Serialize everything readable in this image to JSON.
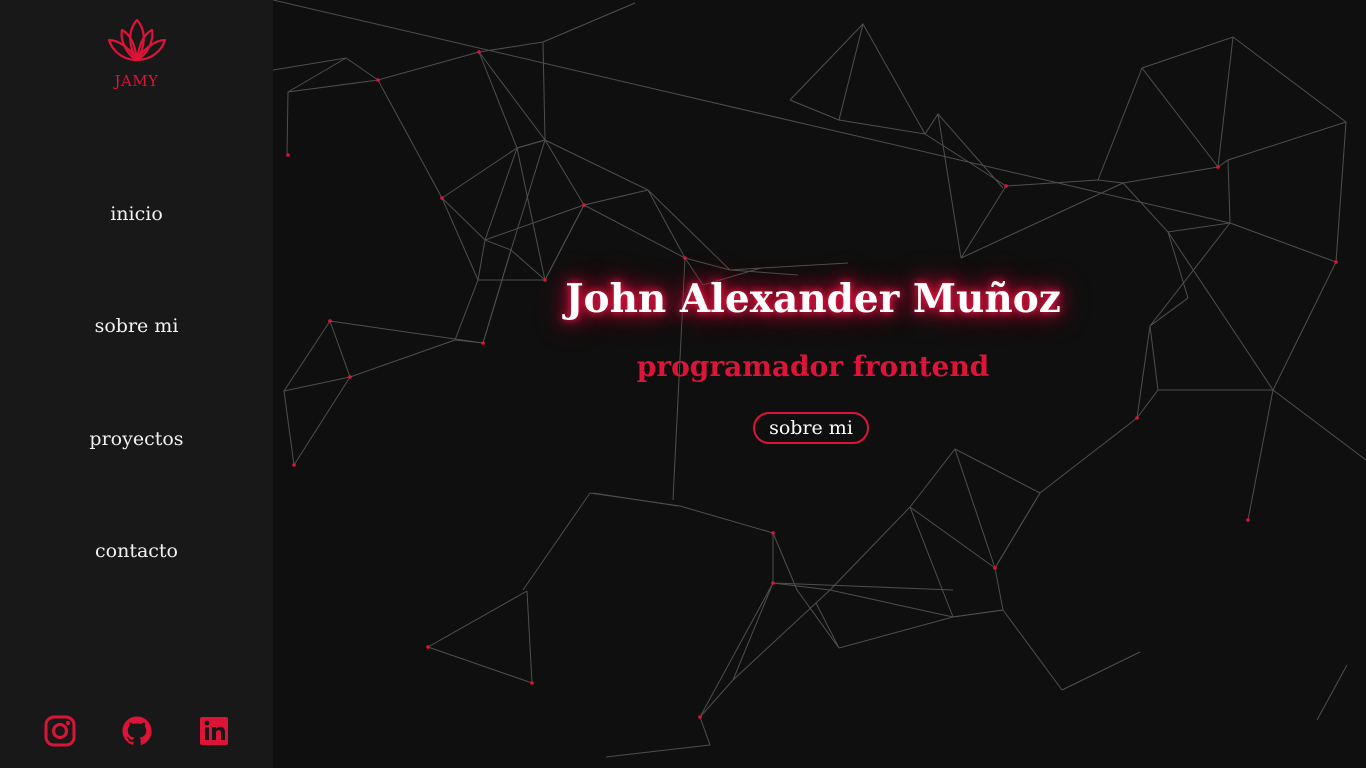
{
  "sidebar": {
    "logo_text": "JAMY",
    "nav": [
      {
        "label": "inicio"
      },
      {
        "label": "sobre mi"
      },
      {
        "label": "proyectos"
      },
      {
        "label": "contacto"
      }
    ],
    "social": [
      {
        "icon": "instagram-icon"
      },
      {
        "icon": "github-icon"
      },
      {
        "icon": "linkedin-icon"
      }
    ]
  },
  "hero": {
    "title": "John Alexander Muñoz",
    "subtitle": "programador frontend",
    "button_label": "sobre mi"
  },
  "colors": {
    "accent": "#dc1437",
    "background": "#0f0f0f",
    "sidebar": "#181818",
    "text": "#ffffff"
  }
}
